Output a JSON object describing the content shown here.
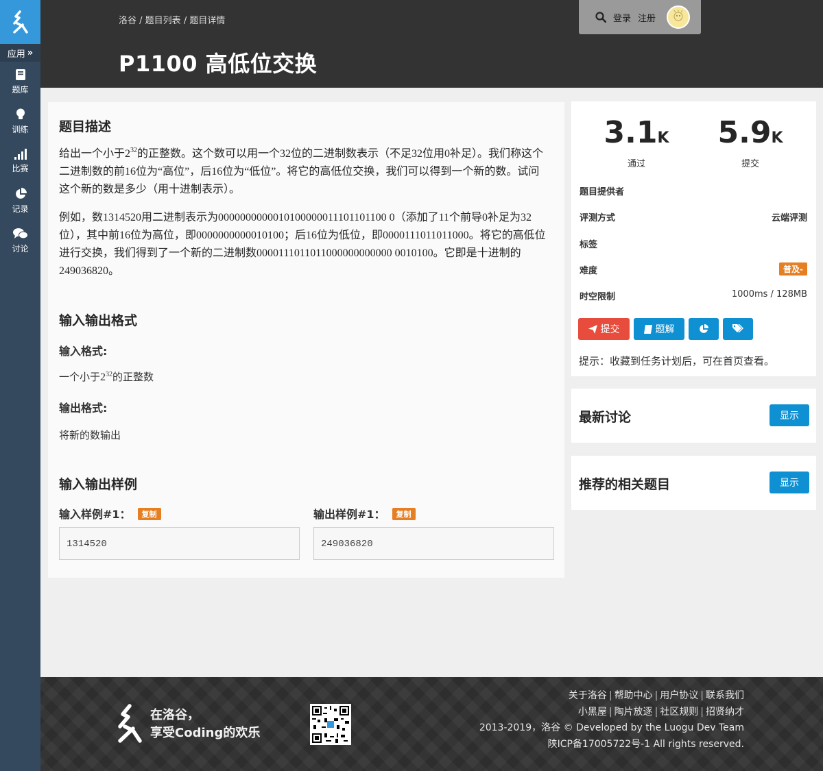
{
  "sidebar": {
    "app_label": "应用",
    "items": [
      {
        "label": "题库",
        "icon": "book-icon"
      },
      {
        "label": "训练",
        "icon": "lightbulb-icon"
      },
      {
        "label": "比赛",
        "icon": "signal-bars-icon"
      },
      {
        "label": "记录",
        "icon": "pie-chart-icon"
      },
      {
        "label": "讨论",
        "icon": "comments-icon"
      }
    ]
  },
  "header": {
    "breadcrumb": [
      "洛谷",
      "题目列表",
      "题目详情"
    ],
    "title": "P1100 高低位交换",
    "login": "登录",
    "register": "注册"
  },
  "problem": {
    "desc_title": "题目描述",
    "desc_p1_a": "给出一个小于",
    "desc_p1_base": "2",
    "desc_p1_exp": "32",
    "desc_p1_b": "的正整数。这个数可以用一个32位的二进制数表示（不足32位用0补足）。我们称这个二进制数的前16位为“高位”，后16位为“低位”。将它的高低位交换，我们可以得到一个新的数。试问这个新的数是多少（用十进制表示）。",
    "desc_p2": "例如，数1314520用二进制表示为0000000000010100000011101101100 0（添加了11个前导0补足为32位），其中前16位为高位，即0000000000010100；后16位为低位，即0000111011011000。将它的高低位进行交换，我们得到了一个新的二进制数0000111011011000000000000 0010100。它即是十进制的249036820。",
    "io_title": "输入输出格式",
    "input_format_label": "输入格式:",
    "input_format_a": "一个小于",
    "input_format_base": "2",
    "input_format_exp": "32",
    "input_format_b": "的正整数",
    "output_format_label": "输出格式:",
    "output_format": "将新的数输出",
    "sample_title": "输入输出样例",
    "sample_in_label": "输入样例#1：",
    "sample_out_label": "输出样例#1：",
    "copy_label": "复制",
    "sample_in": "1314520",
    "sample_out": "249036820"
  },
  "stats": {
    "passed": "3.1",
    "passed_unit": "K",
    "passed_label": "通过",
    "submitted": "5.9",
    "submitted_unit": "K",
    "submitted_label": "提交"
  },
  "info": {
    "provider_label": "题目提供者",
    "judge_label": "评测方式",
    "judge_value": "云端评测",
    "tags_label": "标签",
    "difficulty_label": "难度",
    "difficulty_value": "普及-",
    "limit_label": "时空限制",
    "limit_value": "1000ms / 128MB",
    "submit_btn": "提交",
    "solution_btn": "题解",
    "hint": "提示：收藏到任务计划后，可在首页查看。"
  },
  "discussion": {
    "title": "最新讨论",
    "show": "显示"
  },
  "related": {
    "title": "推荐的相关题目",
    "show": "显示"
  },
  "footer": {
    "slogan_1": "在洛谷，",
    "slogan_2": "享受Coding的欢乐",
    "links_1": [
      "关于洛谷",
      "帮助中心",
      "用户协议",
      "联系我们"
    ],
    "links_2": [
      "小黑屋",
      "陶片放逐",
      "社区规则",
      "招贤纳才"
    ],
    "copyright": "2013-2019，洛谷 © Developed by the Luogu Dev Team",
    "icp": "陕ICP备17005722号-1 All rights reserved."
  },
  "colors": {
    "sidebar": "#34495e",
    "logo_bg": "#3498db",
    "header": "#333333",
    "submit_btn": "#e74c3c",
    "primary_btn": "#0e90d2",
    "badge_orange": "#e67e22"
  }
}
